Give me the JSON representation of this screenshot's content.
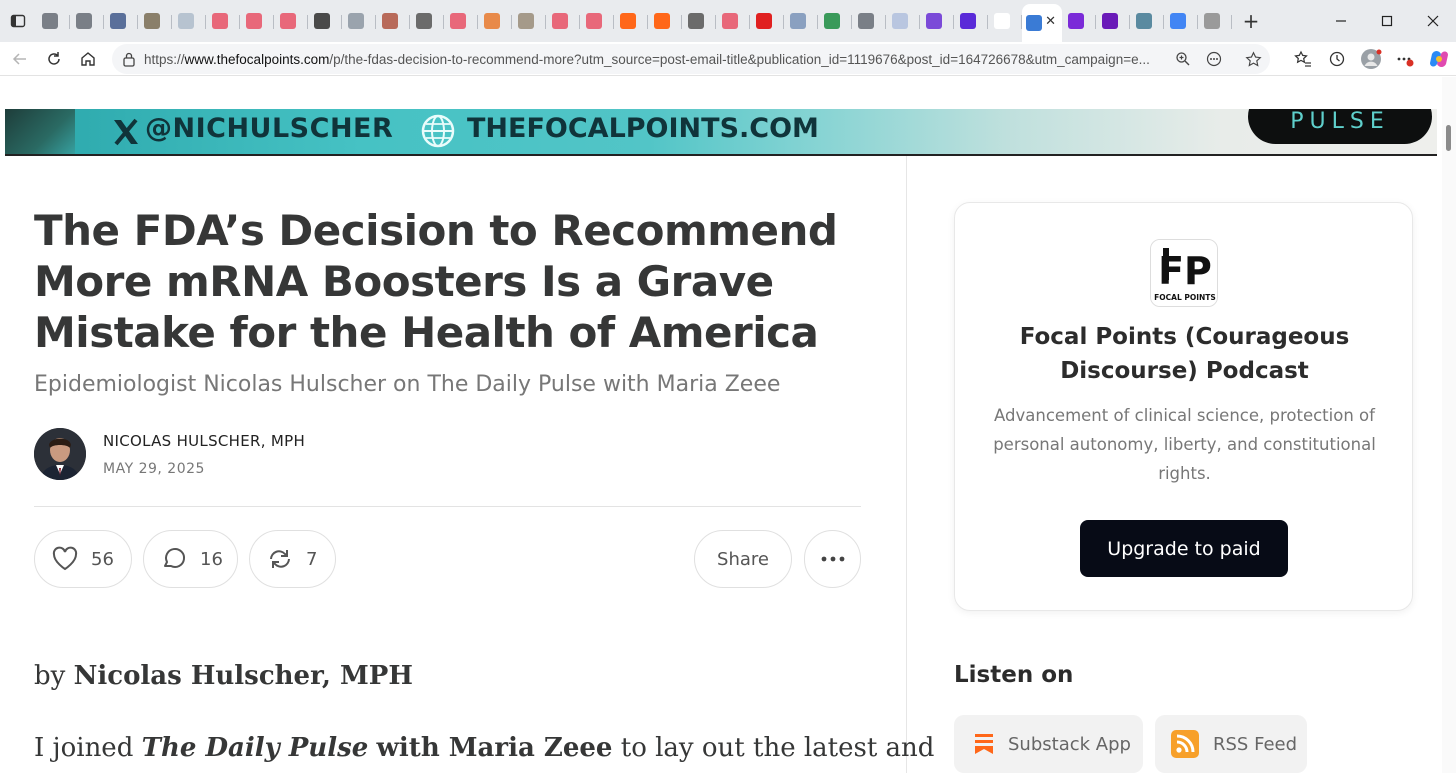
{
  "browser": {
    "tab_favicon_colors": [
      "#7a7f87",
      "#7a7f87",
      "#5a6f9a",
      "#8a7f6a",
      "#b7c3d0",
      "#e8687a",
      "#e8687a",
      "#e8687a",
      "#4a4a4a",
      "#9aa3ad",
      "#b86a5a",
      "#6b6b6b",
      "#e8687a",
      "#e88a4a",
      "#a59a8a",
      "#e8687a",
      "#e8687a",
      "#ff6719",
      "#ff6719",
      "#6b6b6b",
      "#e8687a",
      "#e02020",
      "#8aa0c0",
      "#3a9a5a",
      "#7a7f87",
      "#b9c6e0",
      "#7b4ad8",
      "#5a2ad8",
      "#ffffff",
      "#7b2ad8",
      "#6a1ab8",
      "#5a8aa0",
      "#4285f4",
      "#9a9a9a"
    ],
    "active_tab_close": "✕",
    "url_scheme": "https://",
    "url_host": "www.thefocalpoints.com",
    "url_rest": "/p/the-fdas-decision-to-recommend-more?utm_source=post-email-title&publication_id=1119676&post_id=164726678&utm_campaign=e...",
    "new_tab": "+"
  },
  "banner": {
    "handle": "@NICHULSCHER",
    "site": "THEFOCALPOINTS.COM",
    "pulse": "PULSE"
  },
  "article": {
    "title": "The FDA’s Decision to Recommend More mRNA Boosters Is a Grave Mistake for the Health of America",
    "subtitle": "Epidemiologist Nicolas Hulscher on The Daily Pulse with Maria Zeee",
    "author": "NICOLAS HULSCHER, MPH",
    "date": "MAY 29, 2025",
    "likes": "56",
    "comments": "16",
    "restacks": "7",
    "share_label": "Share",
    "byline_prefix": "by",
    "byline_name": "Nicolas Hulscher, MPH",
    "para_start": "I joined",
    "para_pub": "The Daily Pulse",
    "para_with": "with Maria Zeee",
    "para_end": "to lay out the latest and"
  },
  "sidebar": {
    "logo_text": "FP",
    "logo_sub": "FOCAL POINTS",
    "pub_name": "Focal Points (Courageous Discourse) Podcast",
    "pub_desc": "Advancement of clinical science, protection of personal autonomy, liberty, and constitutional rights.",
    "upgrade_label": "Upgrade to paid",
    "listen_heading": "Listen on",
    "listen_options": [
      "Substack App",
      "RSS Feed"
    ]
  }
}
